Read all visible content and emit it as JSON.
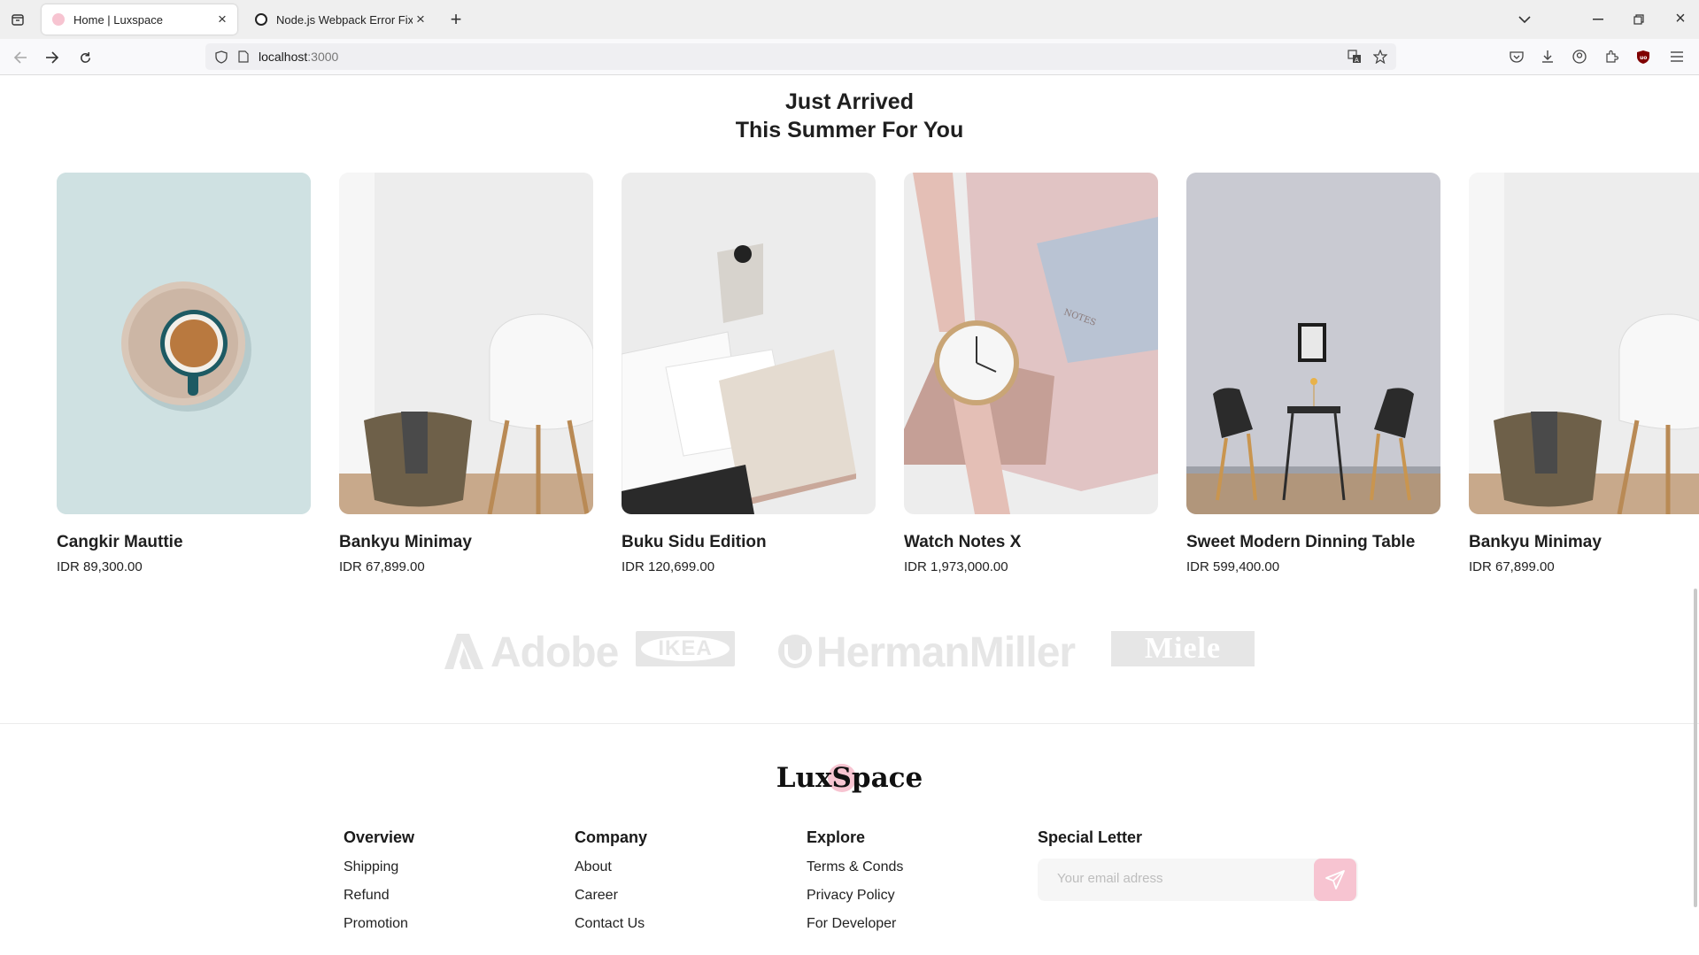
{
  "browser": {
    "tabs": [
      {
        "title": "Home | Luxspace",
        "active": true
      },
      {
        "title": "Node.js Webpack Error Fix",
        "active": false
      }
    ],
    "url": {
      "host": "localhost",
      "port": ":3000"
    }
  },
  "section": {
    "title_line1": "Just Arrived",
    "title_line2": "This Summer For You"
  },
  "products": [
    {
      "name": "Cangkir Mauttie",
      "price": "IDR 89,300.00"
    },
    {
      "name": "Bankyu Minimay",
      "price": "IDR 67,899.00"
    },
    {
      "name": "Buku Sidu Edition",
      "price": "IDR 120,699.00"
    },
    {
      "name": "Watch Notes X",
      "price": "IDR 1,973,000.00"
    },
    {
      "name": "Sweet Modern Dinning Table",
      "price": "IDR 599,400.00"
    },
    {
      "name": "Bankyu Minimay",
      "price": "IDR 67,899.00"
    }
  ],
  "brands": [
    "Adobe",
    "IKEA",
    "HermanMiller",
    "Miele"
  ],
  "footer": {
    "logo": "LuxSpace",
    "columns": [
      {
        "title": "Overview",
        "links": [
          "Shipping",
          "Refund",
          "Promotion"
        ]
      },
      {
        "title": "Company",
        "links": [
          "About",
          "Career",
          "Contact Us"
        ]
      },
      {
        "title": "Explore",
        "links": [
          "Terms & Conds",
          "Privacy Policy",
          "For Developer"
        ]
      }
    ],
    "newsletter": {
      "title": "Special Letter",
      "placeholder": "Your email adress"
    }
  },
  "colors": {
    "accent_pink": "#f7c4d1",
    "brand_gray": "#e6e6e6"
  }
}
